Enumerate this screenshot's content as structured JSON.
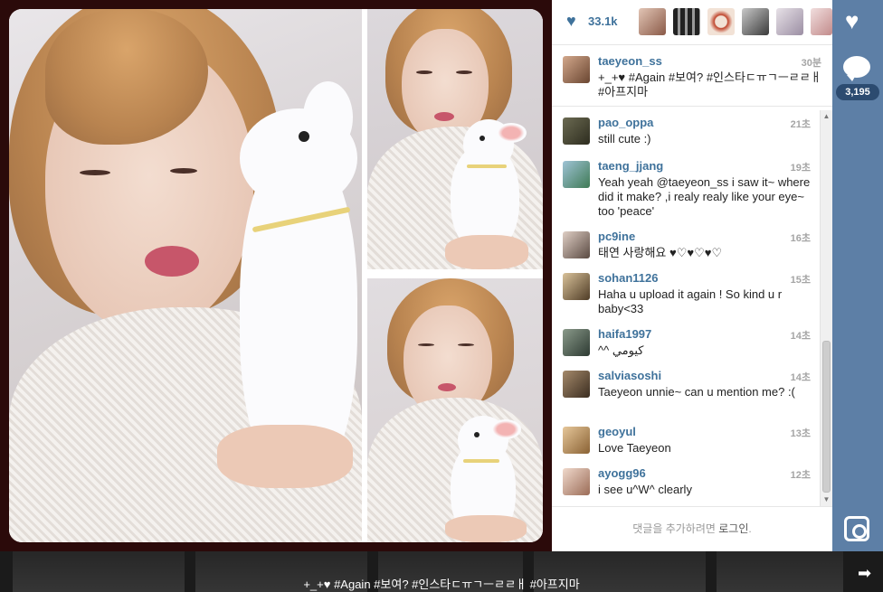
{
  "post": {
    "like_count": "33.1k",
    "comment_count": "3,195",
    "caption_bottom": "+_+♥ #Again #보여? #인스타ㄷㅠㄱㅡㄹㄹㅐ #아프지마"
  },
  "caption": {
    "username": "taeyeon_ss",
    "time": "30분",
    "text": "+_+♥ #Again #보여? #인스타ㄷㅠㄱㅡㄹㄹㅐ #아프지마"
  },
  "comments": [
    {
      "username": "pao_oppa",
      "time": "21초",
      "text": "still cute :)"
    },
    {
      "username": "taeng_jjang",
      "time": "19초",
      "text": "Yeah yeah @taeyeon_ss i saw it~ where did it make? ,i realy realy like your eye~ too 'peace'"
    },
    {
      "username": "pc9ine",
      "time": "16초",
      "text": "태연 사랑해요 ♥♡♥♡♥♡"
    },
    {
      "username": "sohan1126",
      "time": "15초",
      "text": "Haha u upload it again ! So kind u r baby<33"
    },
    {
      "username": "haifa1997",
      "time": "14초",
      "text": "^^ كيومي"
    },
    {
      "username": "salviasoshi",
      "time": "14초",
      "text": "Taeyeon unnie~ can u mention me? :("
    },
    {
      "username": "geoyul",
      "time": "13초",
      "text": "Love Taeyeon"
    },
    {
      "username": "ayogg96",
      "time": "12초",
      "text": "i see u^W^ clearly"
    }
  ],
  "login_prompt": {
    "prefix": "댓글을 추가하려면 ",
    "link": "로그인",
    "suffix": "."
  },
  "icons": {
    "like": "heart-icon",
    "comment": "comment-bubble-icon",
    "instagram": "instagram-camera-icon",
    "next": "arrow-right-icon"
  },
  "colors": {
    "link_blue": "#3f729b",
    "action_bar": "#5d7fa6",
    "count_badge": "#2c4b70"
  }
}
